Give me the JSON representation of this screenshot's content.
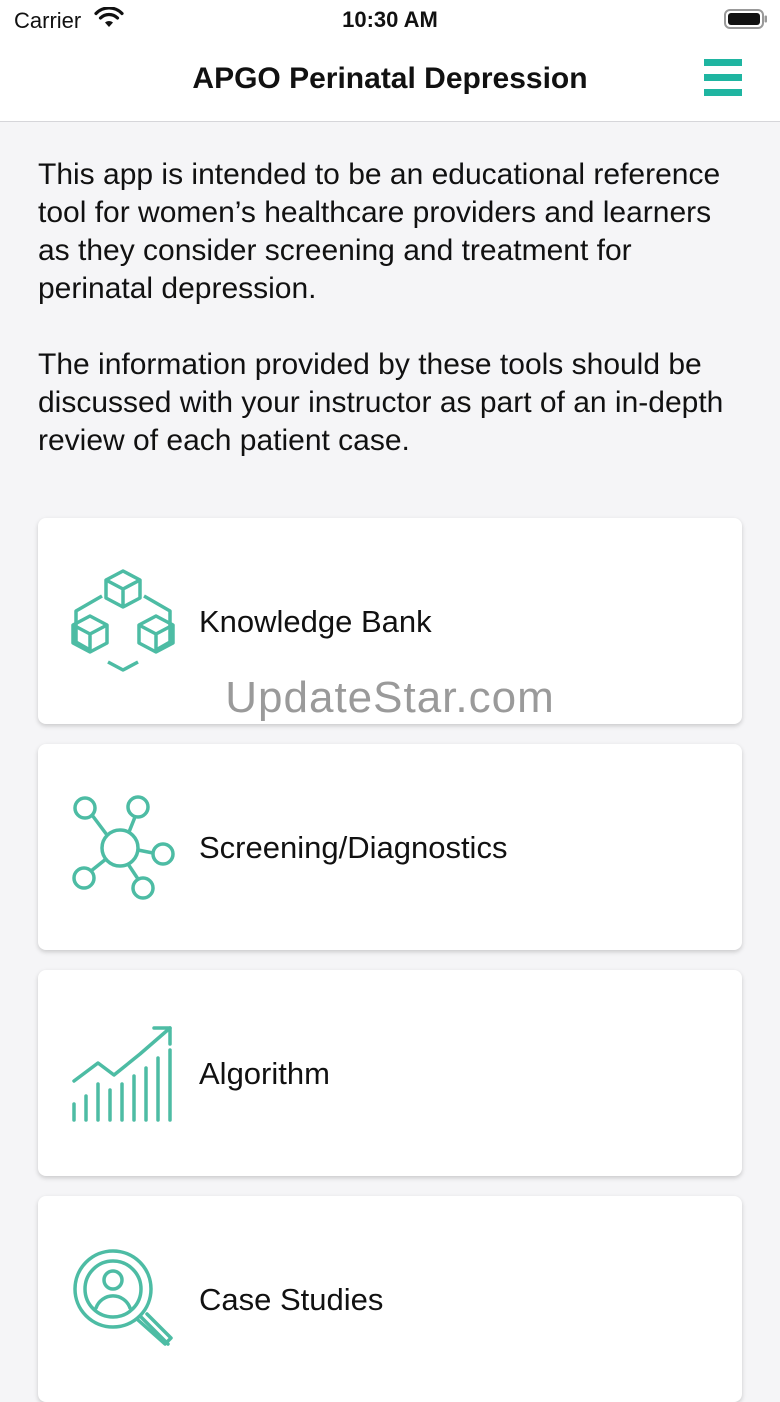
{
  "status_bar": {
    "carrier": "Carrier",
    "time": "10:30 AM"
  },
  "nav": {
    "title": "APGO Perinatal Depression",
    "menu_icon": "hamburger-menu-icon"
  },
  "intro": {
    "paragraph_1": "This app is intended to be an educational reference tool for women’s healthcare providers and learners as they consider screening and treatment for perinatal depression.",
    "paragraph_2": "The information provided by these tools should be discussed with your instructor as part of an in-depth review of each patient case."
  },
  "cards": [
    {
      "label": "Knowledge Bank",
      "icon": "cubes-network-icon"
    },
    {
      "label": "Screening/Diagnostics",
      "icon": "molecule-network-icon"
    },
    {
      "label": "Algorithm",
      "icon": "growth-chart-icon"
    },
    {
      "label": "Case Studies",
      "icon": "magnifier-person-icon"
    }
  ],
  "watermark": "UpdateStar.com",
  "colors": {
    "accent": "#1fb5a1",
    "icon_stroke": "#4dbca4",
    "background": "#f5f5f7"
  }
}
